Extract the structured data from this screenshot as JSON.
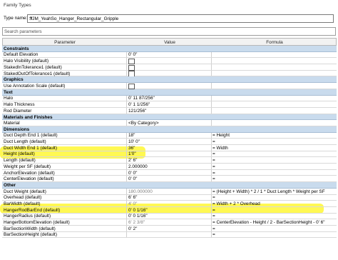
{
  "window": {
    "title": "Family Types"
  },
  "type_name": {
    "label": "Type name:",
    "value": "SJM_YeahSo_Hanger_Rectangular_Gripple"
  },
  "search": {
    "placeholder": "Search parameters"
  },
  "columns": [
    "Parameter",
    "Value",
    "Formula"
  ],
  "groups": [
    {
      "name": "Constraints",
      "rows": [
        {
          "param": "Default Elevation",
          "value": "0'  0\"",
          "formula": ""
        },
        {
          "param": "Halo Visibility (default)",
          "value": "",
          "formula": "",
          "checkbox": true
        },
        {
          "param": "StakedInTolerance1 (default)",
          "value": "",
          "formula": "",
          "checkbox": true
        },
        {
          "param": "StakedOutOfTolerance1 (default)",
          "value": "",
          "formula": "",
          "checkbox": true
        }
      ]
    },
    {
      "name": "Graphics",
      "rows": [
        {
          "param": "Use Annotation Scale (default)",
          "value": "",
          "formula": "",
          "checkbox": true
        }
      ]
    },
    {
      "name": "Text",
      "rows": [
        {
          "param": "Halo",
          "value": "0'  11 87/256\"",
          "formula": ""
        },
        {
          "param": "Halo Thickness",
          "value": "0'  1 1/256\"",
          "formula": ""
        },
        {
          "param": "Rod Diameter",
          "value": "121/256\"",
          "formula": ""
        }
      ]
    },
    {
      "name": "Materials and Finishes",
      "rows": [
        {
          "param": "Material",
          "value": "<By Category>",
          "formula": ""
        }
      ]
    },
    {
      "name": "Dimensions",
      "rows": [
        {
          "param": "Duct Depth End 1 (default)",
          "value": "18\"",
          "formula": "= Height"
        },
        {
          "param": "Duct Length (default)",
          "value": "10'  0\"",
          "formula": "="
        },
        {
          "param": "Duct Width End 1 (default)",
          "value": "36\"",
          "formula": "= Width"
        },
        {
          "param": "Height (default)",
          "value": "1'0\"",
          "formula": "="
        },
        {
          "param": "Length (default)",
          "value": "2'  6\"",
          "formula": "="
        },
        {
          "param": "Weight per SF (default)",
          "value": "2.000000",
          "formula": "="
        },
        {
          "param": "AnchorElevation (default)",
          "value": "0'  0\"",
          "formula": "="
        },
        {
          "param": "CenterElevation (default)",
          "value": "0'  0\"",
          "formula": "="
        }
      ]
    },
    {
      "name": "Other",
      "rows": [
        {
          "param": "Duct Weight (default)",
          "value": "180.000000",
          "formula": "= (Height + Width) * 2 / 1 * Duct Length * Weight per SF",
          "gray": true
        },
        {
          "param": "Overhead (default)",
          "value": "6'  6\"",
          "formula": "="
        },
        {
          "param": "BarWidth (default)",
          "value": "4'  0\"",
          "formula": "= Width + 2 * Overhead",
          "gray": true
        },
        {
          "param": "HangerRodBarEnd (default)",
          "value": "0'  0 1/16\"",
          "formula": "="
        },
        {
          "param": "HangerRadius (default)",
          "value": "0'  0 1/16\"",
          "formula": "="
        },
        {
          "param": "HangerBottomElevation (default)",
          "value": "6'  2 3/8\"",
          "formula": "= CenterElevation - Height / 2 - BarSectionHeight - 0' 6\"",
          "gray": true
        },
        {
          "param": "BarSectionWidth (default)",
          "value": "0'  2\"",
          "formula": "="
        },
        {
          "param": "BarSectionHeight (default)",
          "value": "",
          "formula": "="
        }
      ]
    }
  ]
}
